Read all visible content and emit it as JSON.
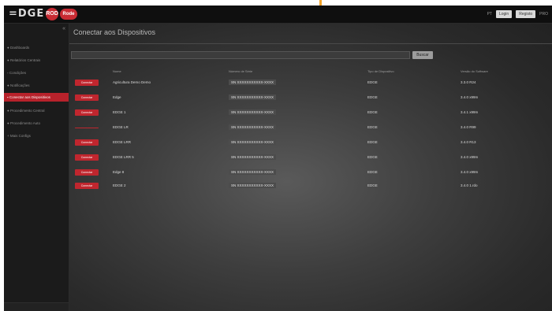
{
  "app": {
    "logo_text": "=DGE",
    "brand_circle": "ROD",
    "brand_oval": "Rode"
  },
  "topbar": {
    "lang": "PT",
    "login_label": "Login",
    "register_label": "Registo",
    "extra_text": "PRO"
  },
  "sidebar": {
    "items": [
      {
        "label": "Dashboards",
        "icon": "dashboard-icon"
      },
      {
        "label": "Relatórios Centrais",
        "icon": "report-icon"
      },
      {
        "label": "Condições",
        "icon": "list-icon"
      },
      {
        "label": "Notificações",
        "icon": "bell-icon"
      },
      {
        "label": "Conectar aos Dispositivos",
        "icon": "connect-icon",
        "active": true
      },
      {
        "label": "Procedimento Central",
        "icon": "procedure-icon"
      },
      {
        "label": "Procedimento Auto",
        "icon": "gear-icon"
      },
      {
        "label": "Mais Configs",
        "icon": "plus-icon"
      }
    ]
  },
  "main": {
    "title": "Conectar aos Dispositivos",
    "search_placeholder": "",
    "search_button": "Buscar",
    "columns": [
      "Nome",
      "Número de Série",
      "Tipo de Dispositivo",
      "Versão do Software"
    ],
    "connect_label": "Conectar",
    "rows": [
      {
        "name": "Agricultura Demo Demo",
        "serial": "SN XXXXXXXXXXX-XXXX",
        "type": "EDGE",
        "version": "3.3.0 R24",
        "state": "button"
      },
      {
        "name": "Edge",
        "serial": "SN XXXXXXXXXXX-XXXX",
        "type": "EDGE",
        "version": "3.4.0 x99m",
        "state": "button"
      },
      {
        "name": "EDGE 1",
        "serial": "SN XXXXXXXXXXX-XXXX",
        "type": "EDGE",
        "version": "3.4.1 x99m",
        "state": "button"
      },
      {
        "name": "EDGE LR",
        "serial": "SN XXXXXXXXXXX-XXXX",
        "type": "EDGE",
        "version": "3.4.0 R99",
        "state": "link"
      },
      {
        "name": "EDGE LRR",
        "serial": "SN XXXXXXXXXXX-XXXX",
        "type": "EDGE",
        "version": "3.4.0 R13",
        "state": "button"
      },
      {
        "name": "EDGE LRR 5",
        "serial": "SN XXXXXXXXXXX-XXXX",
        "type": "EDGE",
        "version": "3.4.0 x99m",
        "state": "button"
      },
      {
        "name": "Edge 8",
        "serial": "SN XXXXXXXXXXX-XXXX",
        "type": "EDGE",
        "version": "3.4.0 x99m",
        "state": "button"
      },
      {
        "name": "EDGE 2",
        "serial": "SN XXXXXXXXXXX-XXXX",
        "type": "EDGE",
        "version": "3.4.0 1.rdo",
        "state": "button"
      }
    ]
  },
  "colors": {
    "accent": "#c0262e",
    "highlight": "#f2a32a",
    "background": "#1e1e1e"
  }
}
